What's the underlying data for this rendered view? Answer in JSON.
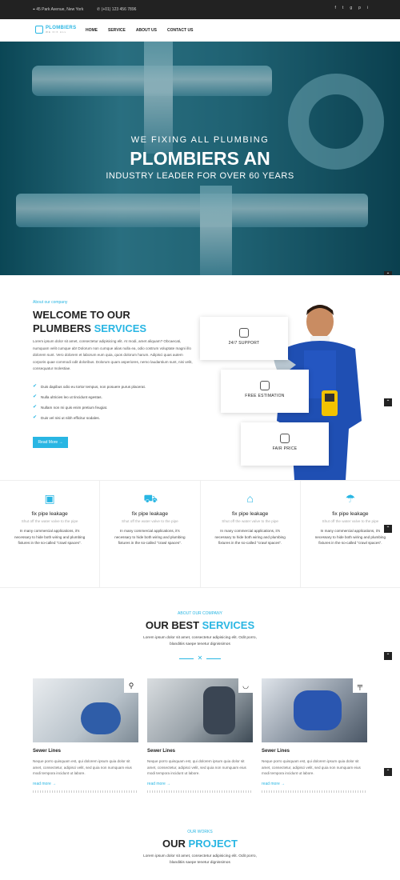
{
  "topbar": {
    "address": "45 Park Avenue, New York",
    "phone": "(+01) 123 456 7896",
    "socials": [
      "f",
      "t",
      "g",
      "p",
      "i"
    ]
  },
  "nav": {
    "logo_name": "PLOMBIERS",
    "logo_tag": "WE FIX ALL",
    "items": [
      "HOME",
      "SERVICE",
      "ABOUT US",
      "CONTACT US"
    ]
  },
  "hero": {
    "subtitle": "WE FIXING ALL PLUMBING",
    "title": "PLOMBIERS AN",
    "tagline": "INDUSTRY LEADER FOR OVER 60 YEARS"
  },
  "welcome": {
    "kicker": "About our company",
    "heading_line1": "WELCOME TO OUR",
    "heading_line2_plain": "PLUMBERS ",
    "heading_line2_accent": "SERVICES",
    "paragraph": "Lorem ipsum dolor sit amet, consectetur adipisicing elit. At modi, amet aliquam? Obcaecati, numquam velit cumque ab! Dolorum non cumque alias nulla ea, odio costrum voluptate magni illo dolorem sunt. Vero dolorem et laborum eum quia, quos dolorum harum. Adipisci quas autem corporis quae commodi odit doloribus. Dolorum quam asperiores, nemo laudantium sunt, nisi velit, consequatur molestiae.",
    "checks": [
      "Duis dapibus odio eu tortor tempus, non posuere purus placerat.",
      "Nulla ultricies leo ut tincidunt egestas.",
      "Nullam non mi quis enim pretium feugiat.",
      "Duis vel nisi ut nibh efficitur sodales."
    ],
    "read_more": "Read More →",
    "cards": [
      "24/7 SUPPORT",
      "FREE ESTIMATION",
      "FAIR PRICE"
    ]
  },
  "features": [
    {
      "icon": "safe-icon",
      "title": "fix pipe leakage",
      "subtitle": "Shut off the water valve to the pipe",
      "text": "In many commercial applications, it's necessary to hide both wiring and plumbing fixtures in the so-called \"crawl spaces\"."
    },
    {
      "icon": "car-icon",
      "title": "fix pipe leakage",
      "subtitle": "Shut off the water valve to the pipe",
      "text": "In many commercial applications, it's necessary to hide both wiring and plumbing fixtures in the so-called \"crawl spaces\"."
    },
    {
      "icon": "router-icon",
      "title": "fix pipe leakage",
      "subtitle": "Shut off the water valve to the pipe",
      "text": "In many commercial applications, it's necessary to hide both wiring and plumbing fixtures in the so-called \"crawl spaces\"."
    },
    {
      "icon": "umbrella-icon",
      "title": "fix pipe leakage",
      "subtitle": "Shut off the water valve to the pipe",
      "text": "In many commercial applications, it's necessary to hide both wiring and plumbing fixtures in the so-called \"crawl spaces\"."
    }
  ],
  "services": {
    "kicker": "ABOUT OUR COMPANY",
    "title_plain": "OUR BEST ",
    "title_accent": "SERVICES",
    "description": "Lorem ipsum dolor sit amet, consectetur adipisicing elit. Odit porro, blanditiis saepe tenetur dignissimos",
    "items": [
      {
        "title": "Sewer Lines",
        "text": "Neque porro quisquam est, qui dolorem ipsum quia dolor sit amet, consectetur, adipisci velit, sed quia non numquam eius modi tempora incidunt ut labore.",
        "link": "read more →",
        "badge": "shower-icon"
      },
      {
        "title": "Sewer Lines",
        "text": "Neque porro quisquam est, qui dolorem ipsum quia dolor sit amet, consectetur, adipisci velit, sed quia non numquam eius modi tempora incidunt ut labore.",
        "link": "read more →",
        "badge": "sink-icon"
      },
      {
        "title": "Sewer Lines",
        "text": "Neque porro quisquam est, qui dolorem ipsum quia dolor sit amet, consectetur, adipisci velit, sed quia non numquam eius modi tempora incidunt ut labore.",
        "link": "read more →",
        "badge": "pipe-icon"
      }
    ]
  },
  "project": {
    "kicker": "OUR WORKS",
    "title_plain": "OUR ",
    "title_accent": "PROJECT",
    "description": "Lorem ipsum dolor sit amet, consectetur adipisicing elit. Odit porro, blanditiis saepe tenetur dignissimos"
  },
  "colors": {
    "accent": "#29b6e3",
    "dark": "#222222"
  }
}
